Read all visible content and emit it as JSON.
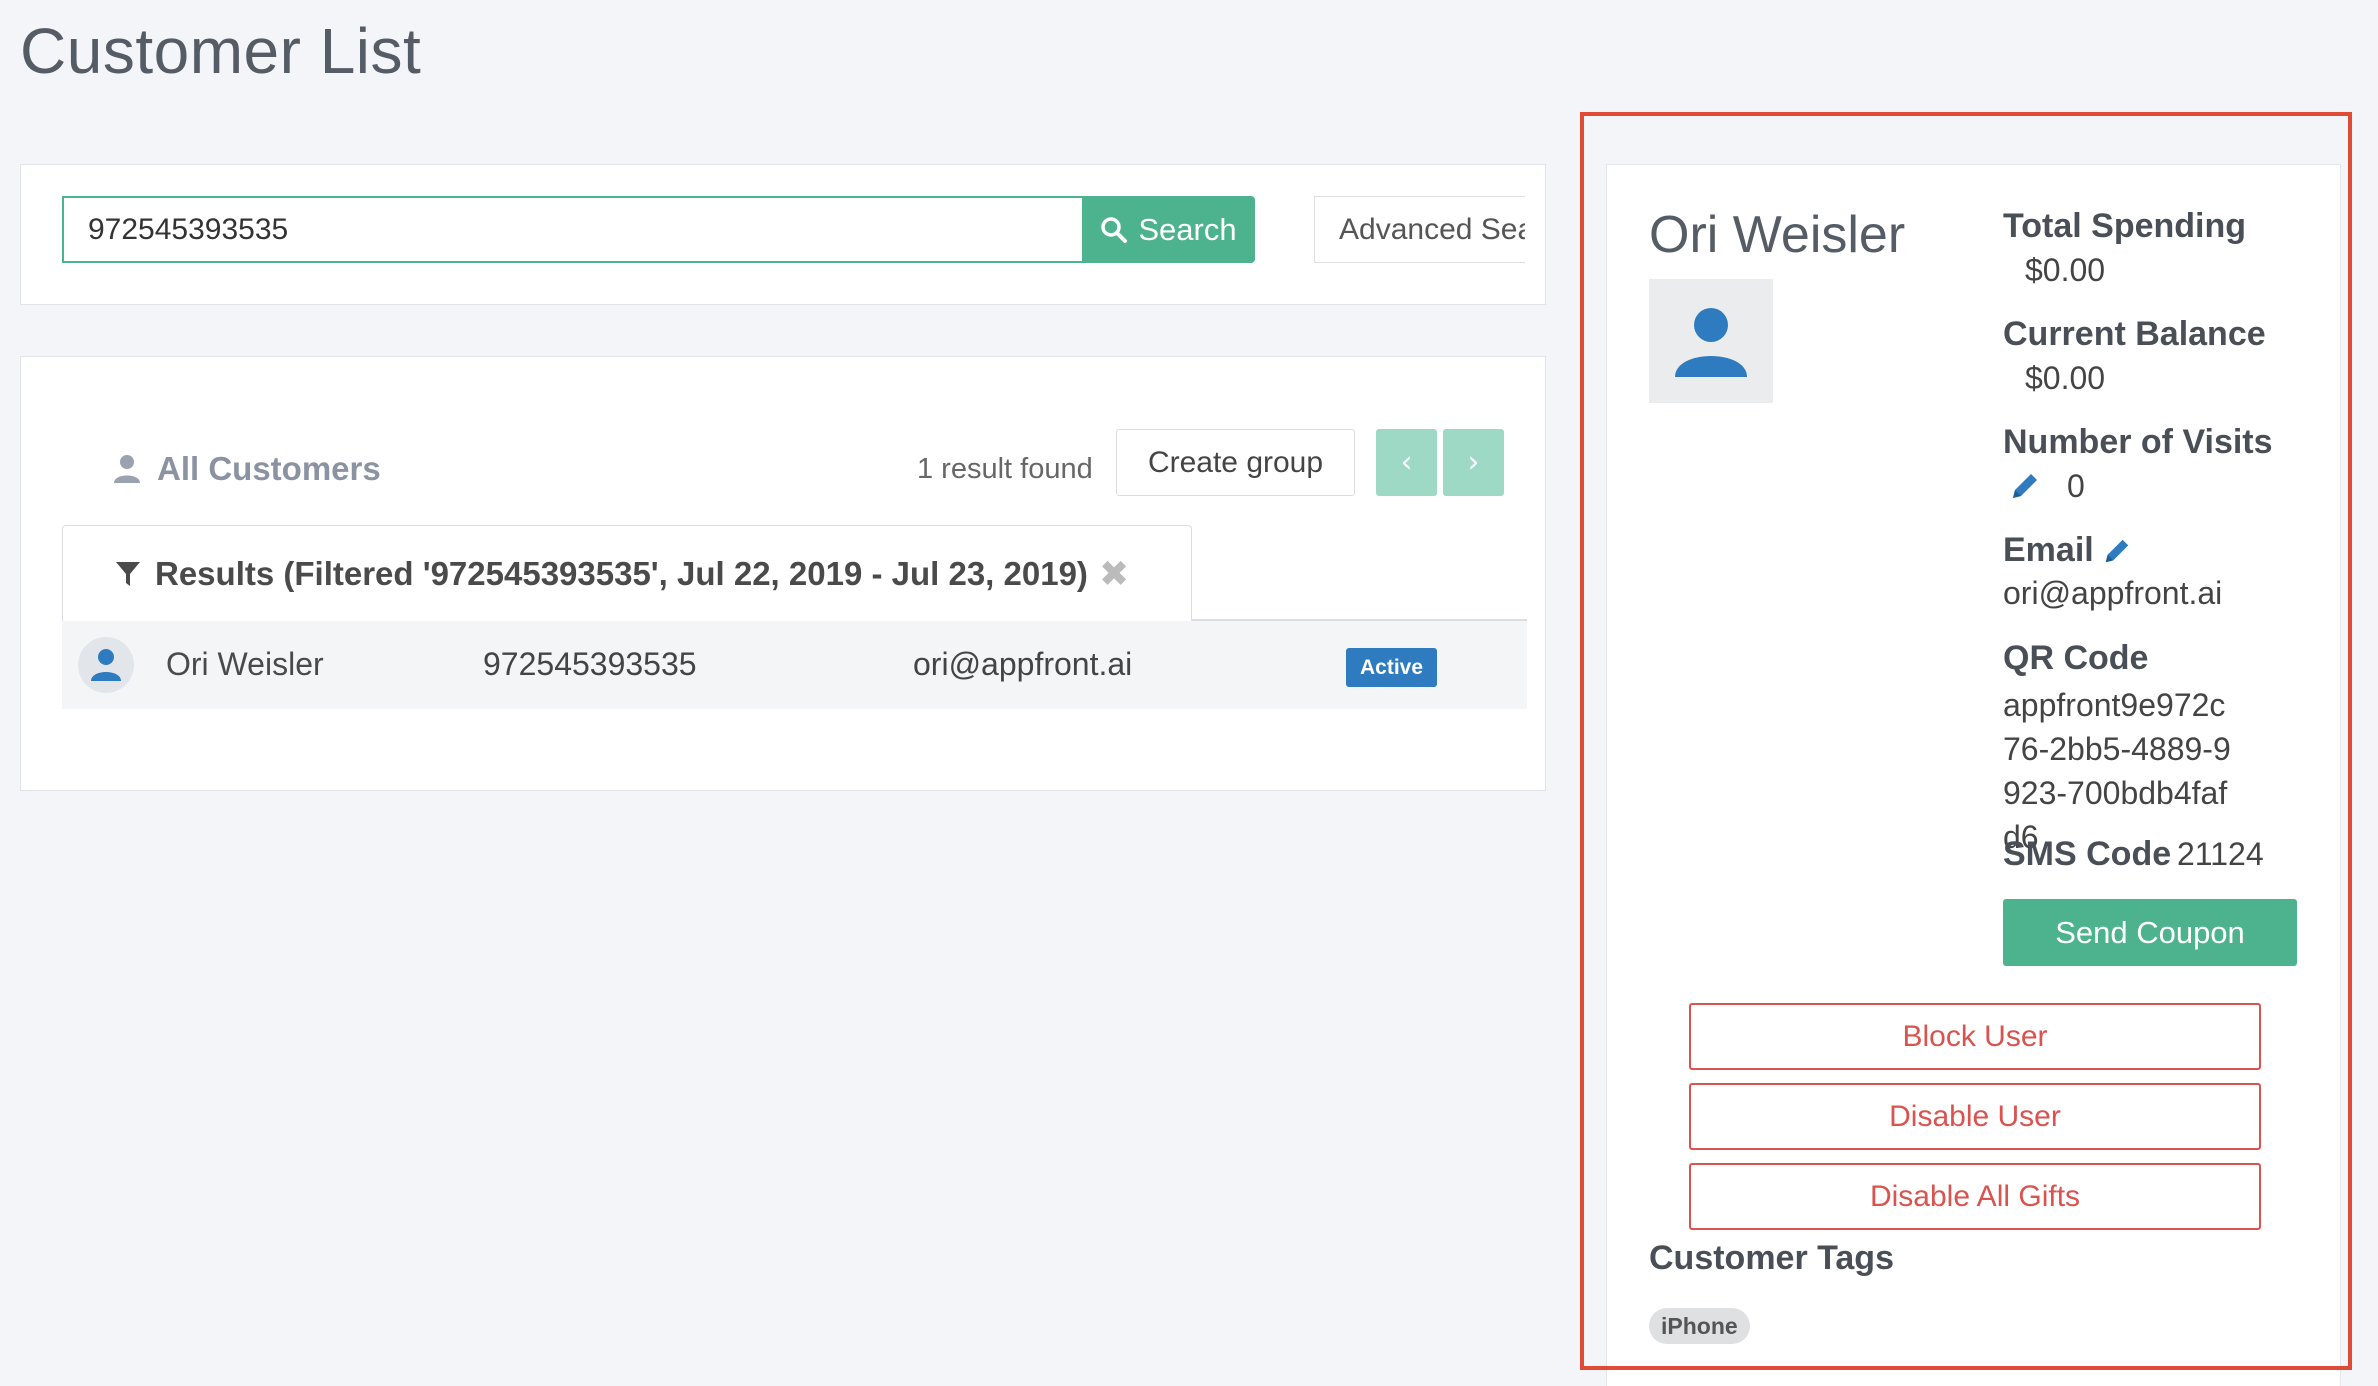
{
  "page": {
    "title": "Customer List"
  },
  "search": {
    "value": "972545393535",
    "button_label": "Search",
    "advanced_label": "Advanced Search"
  },
  "results": {
    "heading": "All Customers",
    "count_text": "1 result found",
    "create_group_label": "Create group",
    "prev_label": "‹",
    "next_label": "›",
    "filter_text": "Results (Filtered '972545393535', Jul 22, 2019 - Jul 23, 2019)",
    "close_label": "✖",
    "rows": [
      {
        "name": "Ori Weisler",
        "phone": "972545393535",
        "email": "ori@appfront.ai",
        "status": "Active"
      }
    ]
  },
  "detail": {
    "name": "Ori Weisler",
    "total_spending_label": "Total Spending",
    "total_spending_value": "$0.00",
    "current_balance_label": "Current Balance",
    "current_balance_value": "$0.00",
    "visits_label": "Number of Visits",
    "visits_value": "0",
    "email_label": "Email",
    "email_value": "ori@appfront.ai",
    "qr_label": "QR Code",
    "qr_value": "appfront9e972c76-2bb5-4889-9923-700bdb4fafd6",
    "sms_label": "SMS Code",
    "sms_value": "21124",
    "send_coupon_label": "Send Coupon",
    "block_user_label": "Block User",
    "disable_user_label": "Disable User",
    "disable_gifts_label": "Disable All Gifts",
    "tags_heading": "Customer Tags",
    "tags": [
      "iPhone"
    ]
  },
  "colors": {
    "accent_green": "#4db38f",
    "pager_green": "#9dd9c4",
    "status_blue": "#2e7bbf",
    "danger_red": "#d9534f",
    "highlight_red": "#e04b35",
    "icon_blue": "#2e7bbf"
  },
  "icons": [
    "search-icon",
    "user-icon",
    "filter-icon",
    "close-icon",
    "chevron-left-icon",
    "chevron-right-icon",
    "avatar-icon",
    "pencil-icon"
  ]
}
